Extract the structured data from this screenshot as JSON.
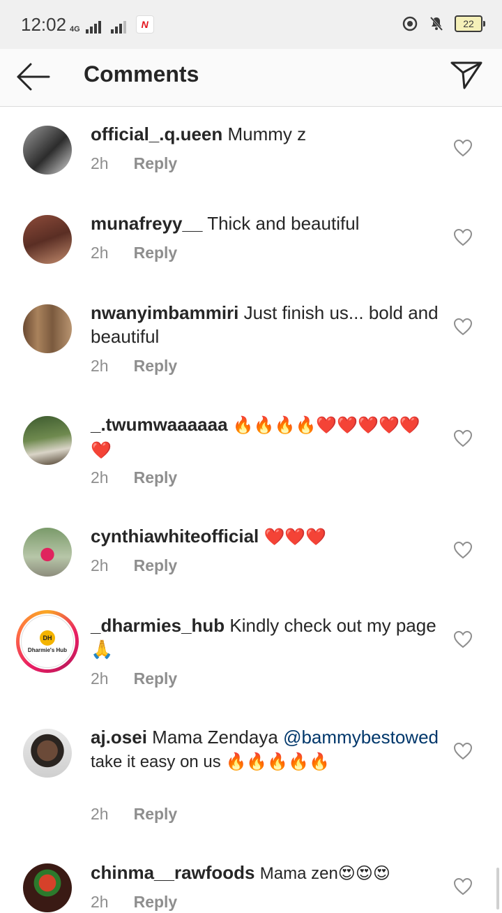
{
  "status_bar": {
    "time": "12:02",
    "network": "4G",
    "battery": "22"
  },
  "header": {
    "title": "Comments"
  },
  "comments": [
    {
      "username": "official_.q.ueen",
      "text": "Mummy z",
      "time": "2h",
      "reply_label": "Reply"
    },
    {
      "username": "munafreyy__",
      "text": "Thick and beautiful",
      "time": "2h",
      "reply_label": "Reply"
    },
    {
      "username": "nwanyimbammiri",
      "text": "Just finish us... bold and beautiful",
      "time": "2h",
      "reply_label": "Reply"
    },
    {
      "username": "_.twumwaaaaaa",
      "text": "🔥🔥🔥🔥❤️❤️❤️❤️❤️❤️",
      "time": "2h",
      "reply_label": "Reply"
    },
    {
      "username": "cynthiawhiteofficial",
      "text": "❤️❤️❤️",
      "time": "2h",
      "reply_label": "Reply"
    },
    {
      "username": "_dharmies_hub",
      "text": "Kindly check out my page 🙏",
      "time": "2h",
      "reply_label": "Reply",
      "avatar_text": "DH",
      "avatar_name": "Dharmie's Hub"
    },
    {
      "username": "aj.osei",
      "text_before": "Mama Zendaya",
      "mention": "@bammybestowed",
      "text_after": "take it easy on us 🔥🔥🔥🔥🔥",
      "time": "2h",
      "reply_label": "Reply"
    },
    {
      "username": "chinma__rawfoods",
      "text": "Mama zen😍😍😍",
      "time": "2h",
      "reply_label": "Reply"
    }
  ],
  "colors": {
    "text": "#262626",
    "meta": "#8e8e8e",
    "mention": "#00376b",
    "header_bg": "#fafafa",
    "status_bg": "#f0f0f0"
  }
}
